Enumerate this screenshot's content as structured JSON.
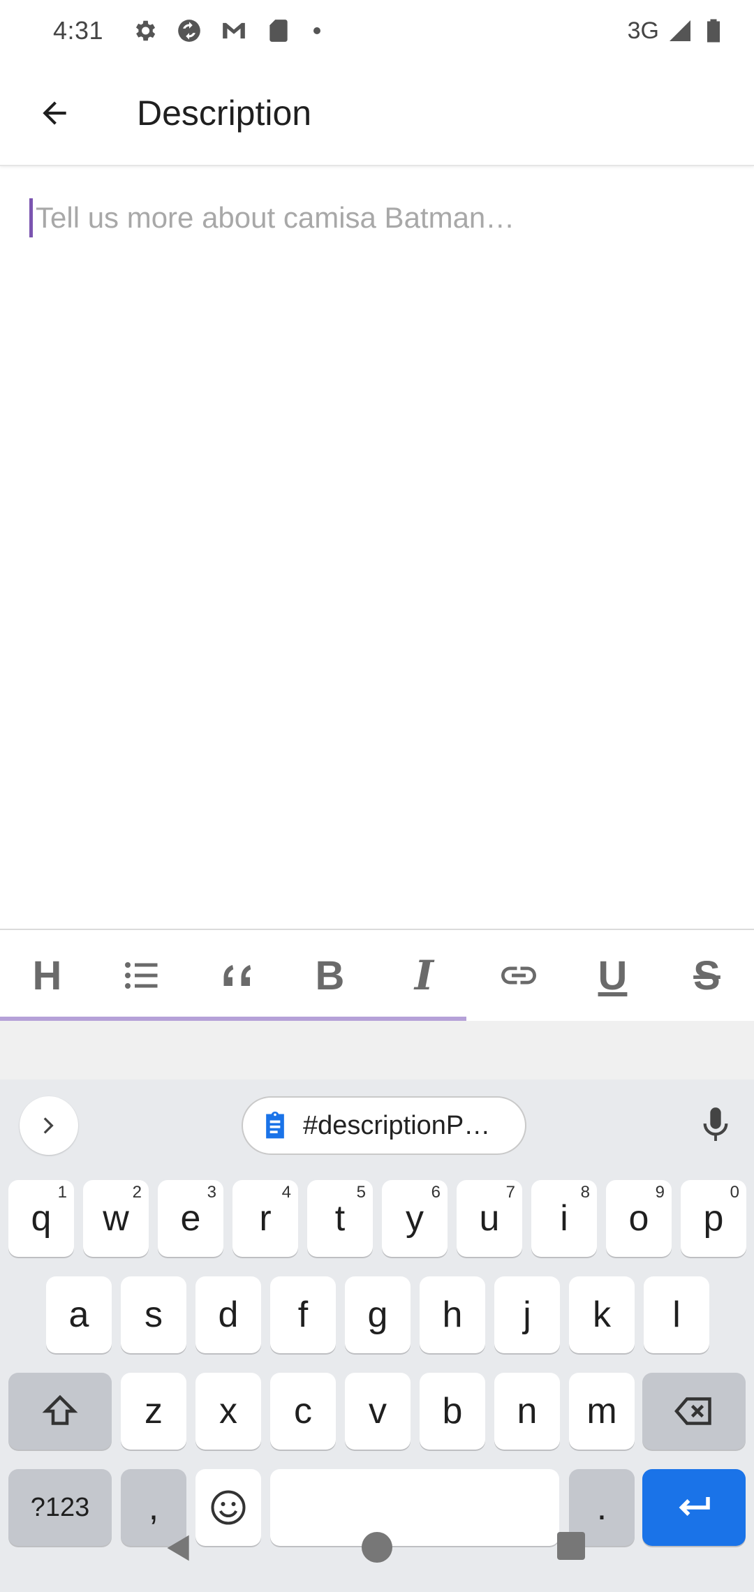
{
  "status_bar": {
    "time": "4:31",
    "network": "3G",
    "icons": [
      "settings-icon",
      "sync-icon",
      "gmail-icon",
      "sd-card-icon",
      "notification-dot-icon",
      "signal-icon",
      "battery-icon"
    ]
  },
  "app_bar": {
    "back_icon": "arrow-back-icon",
    "title": "Description"
  },
  "editor": {
    "placeholder": "Tell us more about camisa Batman…",
    "cursor_color": "#7b55b0"
  },
  "format_toolbar": {
    "items": [
      {
        "name": "heading",
        "glyph": "H"
      },
      {
        "name": "bullet-list",
        "glyph": ""
      },
      {
        "name": "quote",
        "glyph": ""
      },
      {
        "name": "bold",
        "glyph": "B"
      },
      {
        "name": "italic",
        "glyph": "I"
      },
      {
        "name": "link",
        "glyph": ""
      },
      {
        "name": "underline",
        "glyph": "U"
      },
      {
        "name": "strikethrough",
        "glyph": "S"
      }
    ],
    "indicator_color": "#b5a1d8"
  },
  "keyboard": {
    "clipboard_suggestion": "#descriptionP…",
    "row1": [
      {
        "label": "q",
        "hint": "1"
      },
      {
        "label": "w",
        "hint": "2"
      },
      {
        "label": "e",
        "hint": "3"
      },
      {
        "label": "r",
        "hint": "4"
      },
      {
        "label": "t",
        "hint": "5"
      },
      {
        "label": "y",
        "hint": "6"
      },
      {
        "label": "u",
        "hint": "7"
      },
      {
        "label": "i",
        "hint": "8"
      },
      {
        "label": "o",
        "hint": "9"
      },
      {
        "label": "p",
        "hint": "0"
      }
    ],
    "row2": [
      "a",
      "s",
      "d",
      "f",
      "g",
      "h",
      "j",
      "k",
      "l"
    ],
    "row3": [
      "z",
      "x",
      "c",
      "v",
      "b",
      "n",
      "m"
    ],
    "symbols_label": "?123",
    "comma_label": ",",
    "period_label": ".",
    "enter_color": "#1a73e8"
  }
}
